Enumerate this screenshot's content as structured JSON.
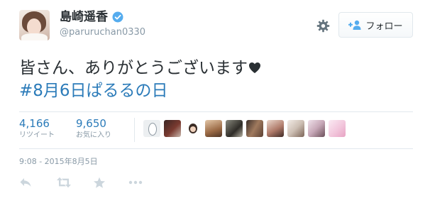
{
  "user": {
    "display_name": "島崎遥香",
    "screen_name": "@paruruchan0330"
  },
  "follow_button": {
    "label": "フォロー"
  },
  "tweet": {
    "line1": "皆さん、ありがとうございます",
    "line2": "#8月6日ぱるるの日"
  },
  "stats": {
    "retweets": {
      "count": "4,166",
      "label": "リツイート"
    },
    "likes": {
      "count": "9,650",
      "label": "お気に入り"
    }
  },
  "timestamp": "9:08 - 2015年8月5日",
  "colors": {
    "link": "#2b7bb9",
    "muted": "#8899a6",
    "text": "#292f33",
    "verified": "#55acee",
    "border": "#e1e8ed"
  },
  "icons": [
    "verified-badge-icon",
    "gear-icon",
    "follow-person-icon",
    "heart-icon",
    "reply-icon",
    "retweet-icon",
    "favorite-star-icon",
    "more-icon"
  ]
}
